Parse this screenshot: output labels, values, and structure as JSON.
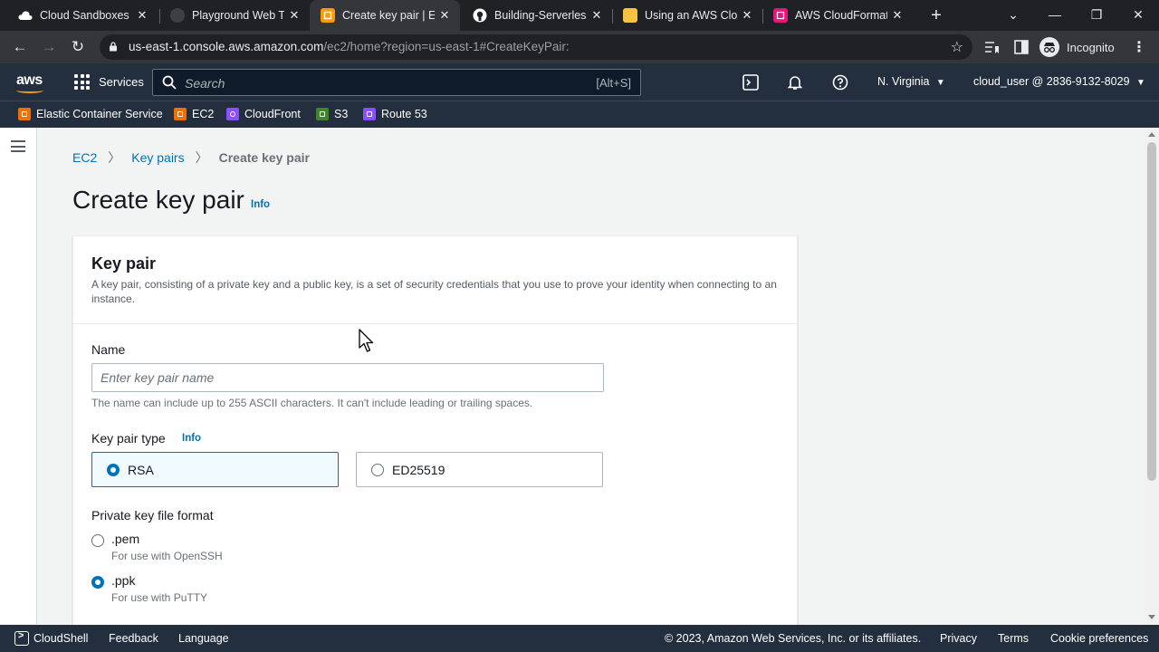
{
  "browser": {
    "tabs": [
      {
        "title": "Cloud Sandboxes - ",
        "favicon_color": "#ffffff"
      },
      {
        "title": "Playground Web Te",
        "favicon_color": "#3c4043"
      },
      {
        "title": "Create key pair | EC",
        "favicon_color": "#ff9900"
      },
      {
        "title": "Building-Serverless",
        "favicon_color": "#ffffff"
      },
      {
        "title": "Using an AWS Clou",
        "favicon_color": "#f5c242"
      },
      {
        "title": "AWS CloudFormatio",
        "favicon_color": "#e7157b"
      }
    ],
    "active_tab_index": 2,
    "url_host": "us-east-1.console.aws.amazon.com",
    "url_rest": "/ec2/home?region=us-east-1#CreateKeyPair:",
    "profile_label": "Incognito"
  },
  "aws_nav": {
    "logo": "aws",
    "services_label": "Services",
    "search_placeholder": "Search",
    "search_shortcut": "[Alt+S]",
    "region": "N. Virginia",
    "account": "cloud_user @ 2836-9132-8029"
  },
  "favorites": [
    {
      "label": "Elastic Container Service",
      "color": "#ed7100"
    },
    {
      "label": "EC2",
      "color": "#ed7100"
    },
    {
      "label": "CloudFront",
      "color": "#8c4fff"
    },
    {
      "label": "S3",
      "color": "#3f8624"
    },
    {
      "label": "Route 53",
      "color": "#8c4fff"
    }
  ],
  "breadcrumb": {
    "items": [
      "EC2",
      "Key pairs"
    ],
    "current": "Create key pair"
  },
  "page": {
    "title": "Create key pair",
    "info": "Info"
  },
  "panel": {
    "title": "Key pair",
    "description": "A key pair, consisting of a private key and a public key, is a set of security credentials that you use to prove your identity when connecting to an instance.",
    "name_label": "Name",
    "name_placeholder": "Enter key pair name",
    "name_value": "",
    "name_hint": "The name can include up to 255 ASCII characters. It can't include leading or trailing spaces.",
    "type_label": "Key pair type",
    "type_info": "Info",
    "type_options": [
      {
        "label": "RSA",
        "selected": true
      },
      {
        "label": "ED25519",
        "selected": false
      }
    ],
    "format_label": "Private key file format",
    "format_options": [
      {
        "label": ".pem",
        "sub": "For use with OpenSSH",
        "selected": false
      },
      {
        "label": ".ppk",
        "sub": "For use with PuTTY",
        "selected": true
      }
    ]
  },
  "footer": {
    "cloudshell": "CloudShell",
    "feedback": "Feedback",
    "language": "Language",
    "copyright": "© 2023, Amazon Web Services, Inc. or its affiliates.",
    "privacy": "Privacy",
    "terms": "Terms",
    "cookies": "Cookie preferences"
  },
  "colors": {
    "aws_nav": "#232f3e",
    "link": "#0073bb",
    "accent_orange": "#ff9900"
  }
}
